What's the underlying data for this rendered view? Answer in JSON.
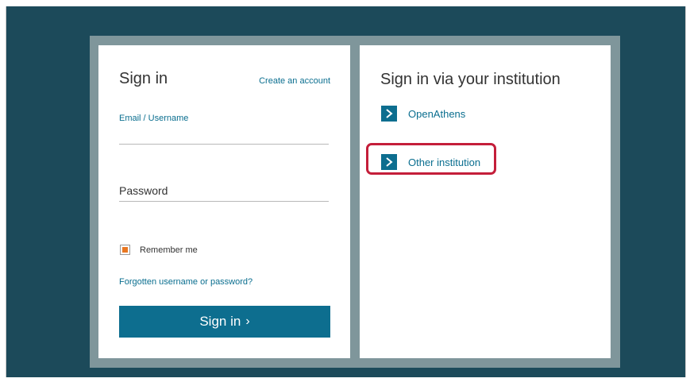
{
  "signin": {
    "title": "Sign in",
    "create_account": "Create an account",
    "email_label": "Email / Username",
    "email_value": "",
    "password_placeholder": "Password",
    "remember_label": "Remember me",
    "remember_checked": true,
    "forgot_link": "Forgotten username or password?",
    "button_label": "Sign in",
    "button_arrow": "›"
  },
  "institution": {
    "title": "Sign in via your institution",
    "items": [
      {
        "label": "OpenAthens"
      },
      {
        "label": "Other institution"
      }
    ]
  },
  "colors": {
    "backdrop": "#1c4a5a",
    "frame": "#7f969b",
    "accent": "#0d6e8f",
    "checkbox_fill": "#e87722",
    "highlight": "#c41e3a"
  }
}
